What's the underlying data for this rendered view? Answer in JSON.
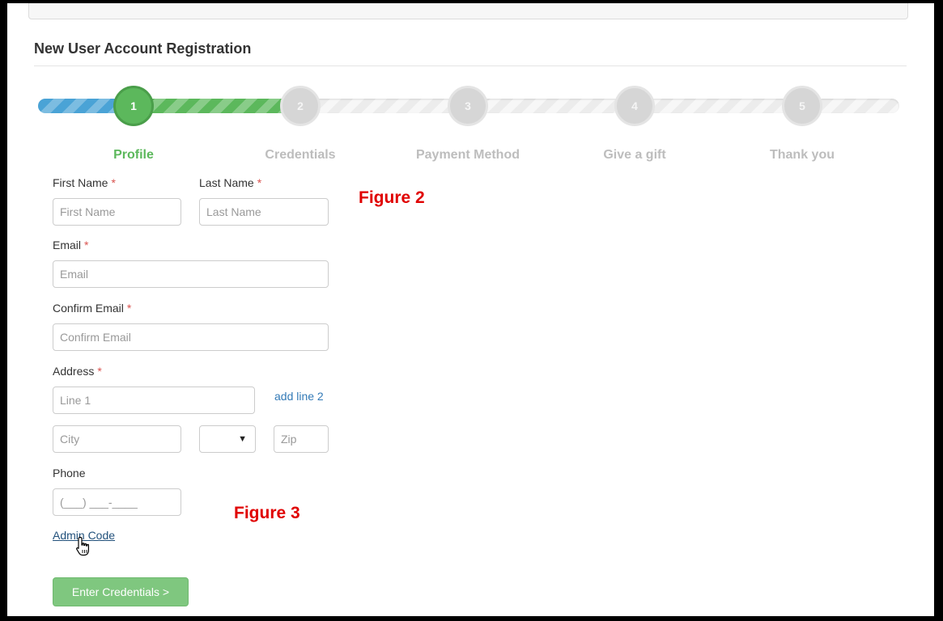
{
  "page": {
    "title": "New User Account Registration"
  },
  "wizard": {
    "steps": [
      {
        "number": "1",
        "label": "Profile"
      },
      {
        "number": "2",
        "label": "Credentials"
      },
      {
        "number": "3",
        "label": "Payment Method"
      },
      {
        "number": "4",
        "label": "Give a gift"
      },
      {
        "number": "5",
        "label": "Thank you"
      }
    ],
    "active_step": 1,
    "colors": {
      "active": "#5cb85c",
      "start": "#4aa3d6",
      "inactive": "#d6d6d6"
    }
  },
  "form": {
    "required_marker": "*",
    "first_name": {
      "label": "First Name",
      "placeholder": "First Name"
    },
    "last_name": {
      "label": "Last Name",
      "placeholder": "Last Name"
    },
    "email": {
      "label": "Email",
      "placeholder": "Email"
    },
    "confirm_email": {
      "label": "Confirm Email",
      "placeholder": "Confirm Email"
    },
    "address": {
      "label": "Address",
      "line1_placeholder": "Line 1",
      "add_line2_link": "add line 2",
      "city_placeholder": "City",
      "state_value": "",
      "zip_placeholder": "Zip"
    },
    "phone": {
      "label": "Phone",
      "placeholder": "(___) ___-____"
    },
    "admin_code_link": "Admin Code",
    "submit_button": "Enter Credentials >"
  },
  "annotations": {
    "figure2": "Figure 2",
    "figure3": "Figure 3"
  }
}
